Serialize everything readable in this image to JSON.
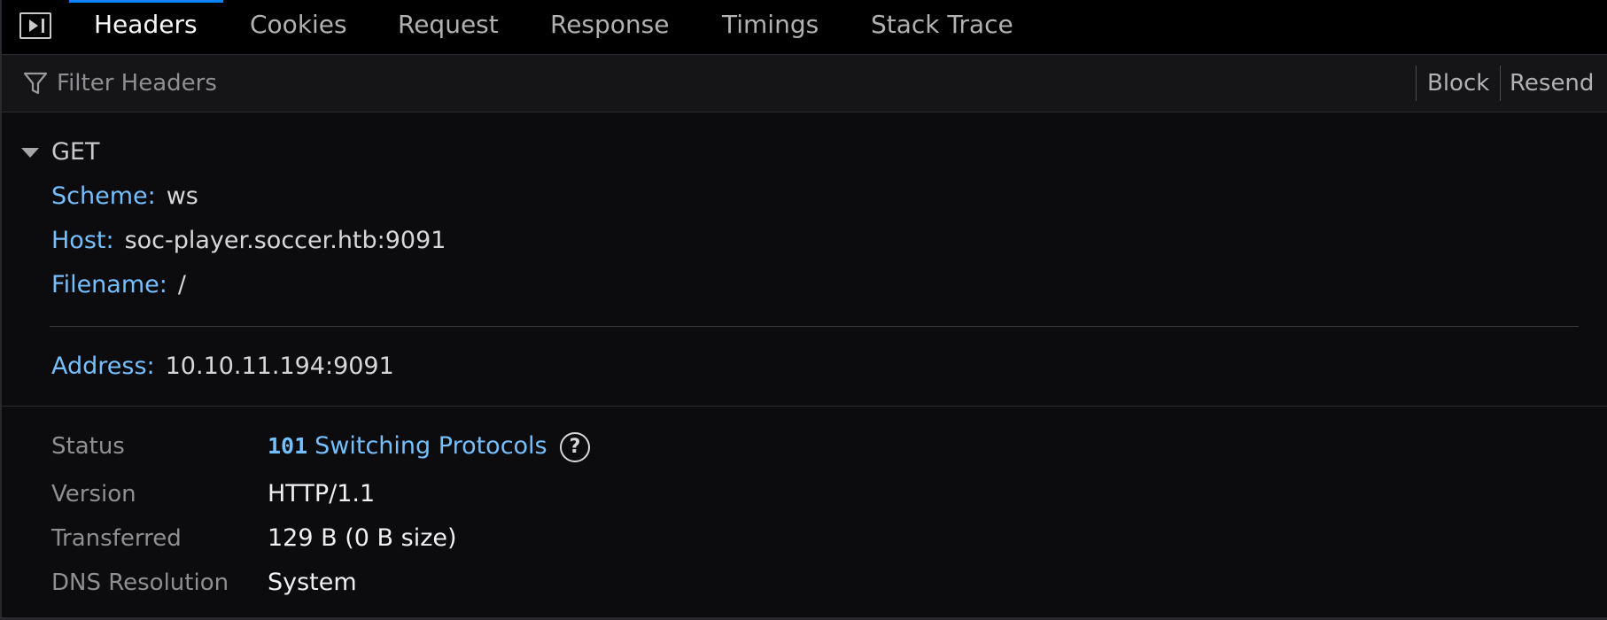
{
  "tabs": [
    {
      "label": "Headers",
      "active": true
    },
    {
      "label": "Cookies",
      "active": false
    },
    {
      "label": "Request",
      "active": false
    },
    {
      "label": "Response",
      "active": false
    },
    {
      "label": "Timings",
      "active": false
    },
    {
      "label": "Stack Trace",
      "active": false
    }
  ],
  "toolbar": {
    "filter_placeholder": "Filter Headers",
    "block_label": "Block",
    "resend_label": "Resend"
  },
  "request": {
    "method": "GET",
    "scheme_label": "Scheme:",
    "scheme_value": "ws",
    "host_label": "Host:",
    "host_value": "soc-player.soccer.htb:9091",
    "filename_label": "Filename:",
    "filename_value": "/",
    "address_label": "Address:",
    "address_value": "10.10.11.194:9091"
  },
  "status": {
    "status_label": "Status",
    "status_code": "101",
    "status_text": "Switching Protocols",
    "help_glyph": "?",
    "version_label": "Version",
    "version_value": "HTTP/1.1",
    "transferred_label": "Transferred",
    "transferred_value": "129 B (0 B size)",
    "dns_label": "DNS Resolution",
    "dns_value": "System"
  },
  "colors": {
    "accent_blue": "#0a84ff",
    "label_blue": "#75bfff",
    "background": "#0c0c0f"
  },
  "icons": {
    "panel_toggle": "sidebar-toggle-icon",
    "filter": "funnel-icon",
    "twisty": "triangle-down-icon",
    "help": "question-circle-icon"
  }
}
